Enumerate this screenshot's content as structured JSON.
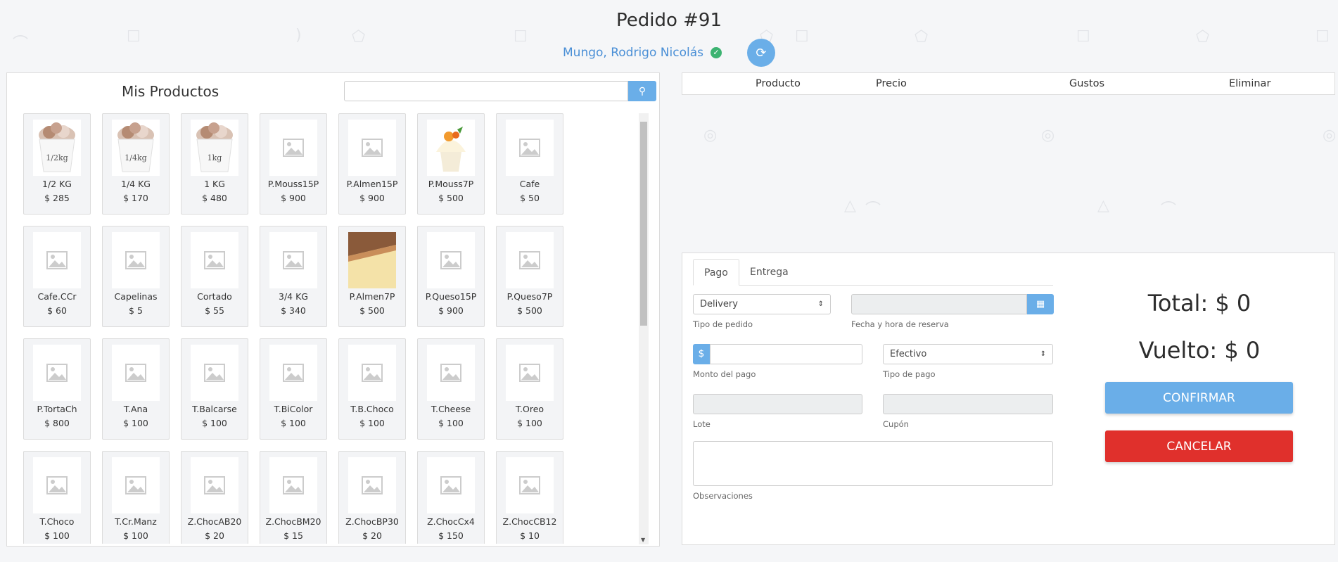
{
  "header": {
    "title": "Pedido #91",
    "customer": "Mungo, Rodrigo Nicolás"
  },
  "products_panel": {
    "title": "Mis Productos",
    "search_value": "",
    "items": [
      {
        "name": "1/2 KG",
        "price": "$ 285",
        "image": "ice-cream-half-kg"
      },
      {
        "name": "1/4 KG",
        "price": "$ 170",
        "image": "ice-cream-quarter-kg"
      },
      {
        "name": "1 KG",
        "price": "$ 480",
        "image": "ice-cream-1kg"
      },
      {
        "name": "P.Mouss15P",
        "price": "$ 900",
        "image": "placeholder"
      },
      {
        "name": "P.Almen15P",
        "price": "$ 900",
        "image": "placeholder"
      },
      {
        "name": "P.Mouss7P",
        "price": "$ 500",
        "image": "mousse-dessert"
      },
      {
        "name": "Cafe",
        "price": "$ 50",
        "image": "placeholder"
      },
      {
        "name": "Cafe.CCr",
        "price": "$ 60",
        "image": "placeholder"
      },
      {
        "name": "Capelinas",
        "price": "$ 5",
        "image": "placeholder"
      },
      {
        "name": "Cortado",
        "price": "$ 55",
        "image": "placeholder"
      },
      {
        "name": "3/4 KG",
        "price": "$ 340",
        "image": "placeholder"
      },
      {
        "name": "P.Almen7P",
        "price": "$ 500",
        "image": "almond-cake"
      },
      {
        "name": "P.Queso15P",
        "price": "$ 900",
        "image": "placeholder"
      },
      {
        "name": "P.Queso7P",
        "price": "$ 500",
        "image": "placeholder"
      },
      {
        "name": "P.TortaCh",
        "price": "$ 800",
        "image": "placeholder"
      },
      {
        "name": "T.Ana",
        "price": "$ 100",
        "image": "placeholder"
      },
      {
        "name": "T.Balcarse",
        "price": "$ 100",
        "image": "placeholder"
      },
      {
        "name": "T.BiColor",
        "price": "$ 100",
        "image": "placeholder"
      },
      {
        "name": "T.B.Choco",
        "price": "$ 100",
        "image": "placeholder"
      },
      {
        "name": "T.Cheese",
        "price": "$ 100",
        "image": "placeholder"
      },
      {
        "name": "T.Oreo",
        "price": "$ 100",
        "image": "placeholder"
      },
      {
        "name": "T.Choco",
        "price": "$ 100",
        "image": "placeholder"
      },
      {
        "name": "T.Cr.Manz",
        "price": "$ 100",
        "image": "placeholder"
      },
      {
        "name": "Z.ChocAB20",
        "price": "$ 20",
        "image": "placeholder"
      },
      {
        "name": "Z.ChocBM20",
        "price": "$ 15",
        "image": "placeholder"
      },
      {
        "name": "Z.ChocBP30",
        "price": "$ 20",
        "image": "placeholder"
      },
      {
        "name": "Z.ChocCx4",
        "price": "$ 150",
        "image": "placeholder"
      },
      {
        "name": "Z.ChocCB12",
        "price": "$ 10",
        "image": "placeholder"
      }
    ]
  },
  "order_table": {
    "columns": [
      "Producto",
      "Precio",
      "Gustos",
      "Eliminar"
    ]
  },
  "payment": {
    "tabs": [
      "Pago",
      "Entrega"
    ],
    "active_tab": "Pago",
    "tipo_pedido_value": "Delivery",
    "tipo_pedido_label": "Tipo de pedido",
    "fecha_value": "",
    "fecha_label": "Fecha y hora de reserva",
    "monto_prefix": "$",
    "monto_value": "",
    "monto_label": "Monto del pago",
    "tipo_pago_value": "Efectivo",
    "tipo_pago_label": "Tipo de pago",
    "lote_value": "",
    "lote_label": "Lote",
    "cupon_value": "",
    "cupon_label": "Cupón",
    "observaciones_label": "Observaciones",
    "total": "Total: $ 0",
    "vuelto": "Vuelto: $ 0",
    "confirm_label": "CONFIRMAR",
    "cancel_label": "CANCELAR"
  },
  "colors": {
    "accent": "#6aaee8",
    "danger": "#e0302c",
    "link": "#4a8fd6",
    "verified": "#3cb371"
  }
}
